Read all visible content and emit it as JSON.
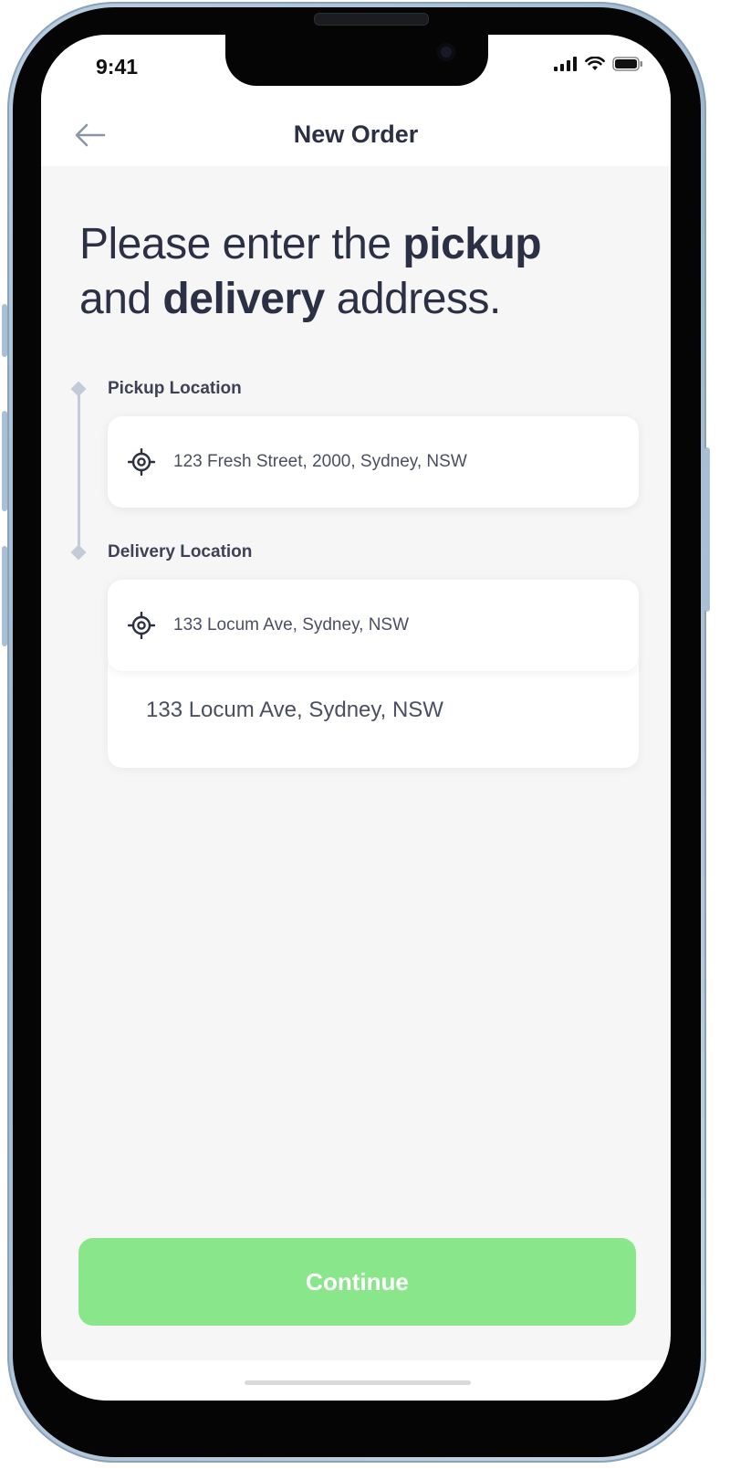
{
  "status_bar": {
    "time": "9:41",
    "icons": [
      "cellular-signal-icon",
      "wifi-icon",
      "battery-icon"
    ]
  },
  "nav": {
    "back_icon": "arrow-left-icon",
    "title": "New Order"
  },
  "headline": {
    "part1": "Please enter the ",
    "bold1": "pickup",
    "part2": "and ",
    "bold2": "delivery",
    "part3": " address."
  },
  "pickup": {
    "label": "Pickup Location",
    "value": "123 Fresh Street, 2000, Sydney, NSW",
    "icon": "location-target-icon"
  },
  "delivery": {
    "label": "Delivery Location",
    "value": "133 Locum Ave, Sydney, NSW",
    "icon": "location-target-icon"
  },
  "suggestions": [
    "133 Locum Ave, Sydney, NSW"
  ],
  "continue_button": {
    "label": "Continue"
  },
  "colors": {
    "primary_text": "#2b3044",
    "button_green": "#8ae68a",
    "screen_background": "#f6f6f6",
    "timeline": "#c3cbd8"
  }
}
